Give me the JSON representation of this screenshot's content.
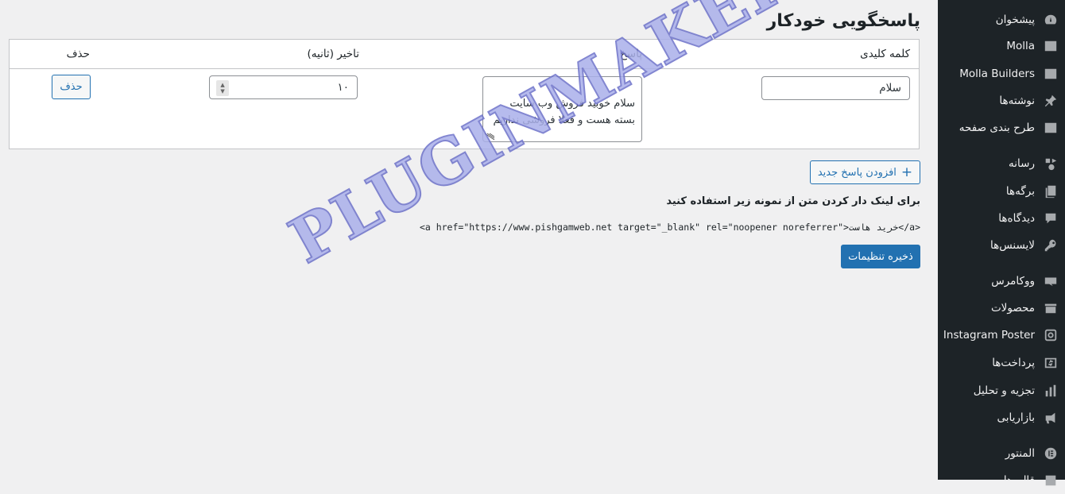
{
  "sidebar": {
    "items": [
      {
        "label": "پیشخوان",
        "icon": "dashboard-icon"
      },
      {
        "label": "Molla",
        "icon": "molla-icon"
      },
      {
        "label": "Molla Builders",
        "icon": "molla-builders-icon"
      },
      {
        "label": "نوشته‌ها",
        "icon": "pin-icon"
      },
      {
        "label": "طرح بندی صفحه",
        "icon": "layout-icon"
      },
      {
        "label": "رسانه",
        "icon": "media-icon"
      },
      {
        "label": "برگه‌ها",
        "icon": "pages-icon"
      },
      {
        "label": "دیدگاه‌ها",
        "icon": "comments-icon"
      },
      {
        "label": "لایسنس‌ها",
        "icon": "key-icon"
      },
      {
        "label": "ووکامرس",
        "icon": "woocommerce-icon"
      },
      {
        "label": "محصولات",
        "icon": "products-icon"
      },
      {
        "label": "Instagram Poster",
        "icon": "instagram-icon"
      },
      {
        "label": "پرداخت‌ها",
        "icon": "payments-icon"
      },
      {
        "label": "تجزیه و تحلیل",
        "icon": "analytics-icon"
      },
      {
        "label": "بازاریابی",
        "icon": "megaphone-icon"
      },
      {
        "label": "المنتور",
        "icon": "elementor-icon"
      },
      {
        "label": "قالب‌ها",
        "icon": "templates-icon"
      }
    ]
  },
  "page": {
    "title": "پاسخگویی خودکار"
  },
  "table": {
    "headers": {
      "keyword": "کلمه کلیدی",
      "reply": "پاسخ",
      "delay": "تاخیر (ثانیه)",
      "delete": "حذف"
    },
    "row": {
      "keyword": "سلام",
      "reply": "سلام خوبید فروش وب سایت\nبسته هست و فعلا فروشی نداریم",
      "delay": "۱۰",
      "delete_label": "حذف"
    }
  },
  "add_button": {
    "label": "افزودن پاسخ جدید",
    "icon": "plus-icon"
  },
  "help": {
    "text": "برای لینک دار کردن متن از نمونه زیر استفاده کنید",
    "code": "<a href=\"https://www.pishgamweb.net target=\"_blank\" rel=\"noopener noreferrer\">خرید هاست</a>"
  },
  "save_button": {
    "label": "ذخیره تنظیمات"
  },
  "watermark": "PLUGINMAKER.IR",
  "colors": {
    "sidebar_bg": "#1d2327",
    "accent": "#2271b1",
    "page_bg": "#f0f0f1",
    "watermark": "#aab0ea"
  }
}
